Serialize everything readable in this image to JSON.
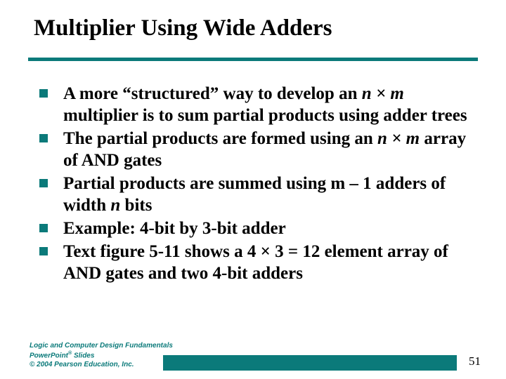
{
  "slide": {
    "title": "Multiplier Using Wide Adders",
    "bullets": [
      {
        "pre": "A more “structured” way to develop an ",
        "em": "n × m",
        "post": " multiplier is to sum partial products using adder trees"
      },
      {
        "pre": "The partial products are formed using an ",
        "em": "n × m",
        "post": " array of AND gates"
      },
      {
        "pre": "Partial products are summed using m – 1 adders of width ",
        "em": "n",
        "post": " bits"
      },
      {
        "pre": "Example:  4-bit by 3-bit adder",
        "em": "",
        "post": ""
      },
      {
        "pre": "Text figure 5-11 shows a 4 × 3 = 12 element array of AND gates and two 4-bit adders",
        "em": "",
        "post": ""
      }
    ],
    "footer": {
      "line1": "Logic and Computer Design Fundamentals",
      "line2a": "PowerPoint",
      "line2sup": "®",
      "line2b": " Slides",
      "line3": "© 2004 Pearson Education, Inc."
    },
    "page_number": "51"
  }
}
